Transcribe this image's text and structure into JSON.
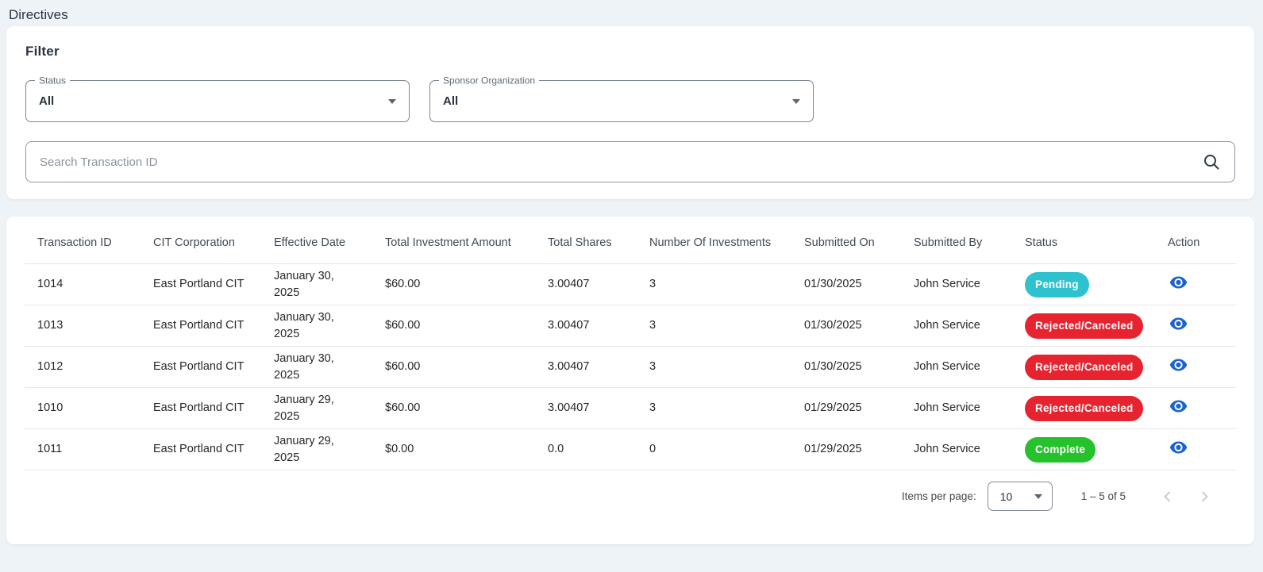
{
  "page": {
    "title": "Directives"
  },
  "filter": {
    "heading": "Filter",
    "status_select": {
      "label": "Status",
      "value": "All"
    },
    "sponsor_select": {
      "label": "Sponsor Organization",
      "value": "All"
    },
    "search": {
      "placeholder": "Search Transaction ID"
    }
  },
  "table": {
    "columns": [
      "Transaction ID",
      "CIT Corporation",
      "Effective Date",
      "Total Investment Amount",
      "Total Shares",
      "Number Of Investments",
      "Submitted On",
      "Submitted By",
      "Status",
      "Action"
    ],
    "rows": [
      {
        "transaction_id": "1014",
        "cit_corporation": "East Portland CIT",
        "effective_date": "January 30, 2025",
        "total_investment_amount": "$60.00",
        "total_shares": "3.00407",
        "number_of_investments": "3",
        "submitted_on": "01/30/2025",
        "submitted_by": "John Service",
        "status": "Pending",
        "status_class": "badge badge-pending"
      },
      {
        "transaction_id": "1013",
        "cit_corporation": "East Portland CIT",
        "effective_date": "January 30, 2025",
        "total_investment_amount": "$60.00",
        "total_shares": "3.00407",
        "number_of_investments": "3",
        "submitted_on": "01/30/2025",
        "submitted_by": "John Service",
        "status": "Rejected/Canceled",
        "status_class": "badge badge-rejected"
      },
      {
        "transaction_id": "1012",
        "cit_corporation": "East Portland CIT",
        "effective_date": "January 30, 2025",
        "total_investment_amount": "$60.00",
        "total_shares": "3.00407",
        "number_of_investments": "3",
        "submitted_on": "01/30/2025",
        "submitted_by": "John Service",
        "status": "Rejected/Canceled",
        "status_class": "badge badge-rejected"
      },
      {
        "transaction_id": "1010",
        "cit_corporation": "East Portland CIT",
        "effective_date": "January 29, 2025",
        "total_investment_amount": "$60.00",
        "total_shares": "3.00407",
        "number_of_investments": "3",
        "submitted_on": "01/29/2025",
        "submitted_by": "John Service",
        "status": "Rejected/Canceled",
        "status_class": "badge badge-rejected"
      },
      {
        "transaction_id": "1011",
        "cit_corporation": "East Portland CIT",
        "effective_date": "January 29, 2025",
        "total_investment_amount": "$0.00",
        "total_shares": "0.0",
        "number_of_investments": "0",
        "submitted_on": "01/29/2025",
        "submitted_by": "John Service",
        "status": "Complete",
        "status_class": "badge badge-complete"
      }
    ]
  },
  "pagination": {
    "items_per_page_label": "Items per page:",
    "items_per_page_value": "10",
    "range_label": "1 – 5 of 5"
  },
  "colors": {
    "status_pending": "#2ec2cf",
    "status_rejected": "#e6232f",
    "status_complete": "#26c22c",
    "action_icon": "#1a63d0",
    "page_background": "#eef3f7"
  }
}
